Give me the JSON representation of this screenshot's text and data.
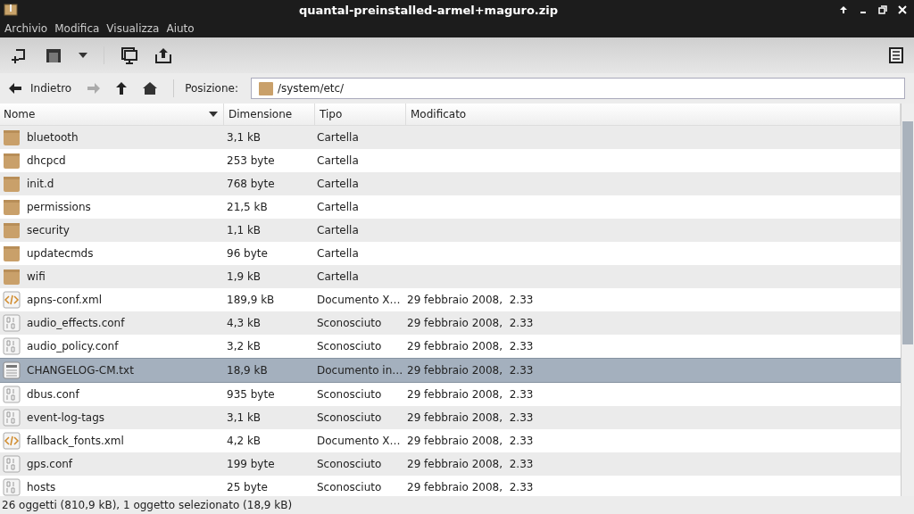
{
  "window": {
    "title": "quantal-preinstalled-armel+maguro.zip"
  },
  "menu": [
    "Archivio",
    "Modifica",
    "Visualizza",
    "Aiuto"
  ],
  "nav": {
    "back": "Indietro",
    "location_label": "Posizione:",
    "location": "/system/etc/"
  },
  "table": {
    "columns": [
      {
        "label": "Nome",
        "sorted": true
      },
      {
        "label": "Dimensione",
        "sorted": false
      },
      {
        "label": "Tipo",
        "sorted": false
      },
      {
        "label": "Modificato",
        "sorted": false
      }
    ],
    "rows": [
      {
        "kind": "folder",
        "name": "bluetooth",
        "size": "3,1 kB",
        "type": "Cartella",
        "selected": false
      },
      {
        "kind": "folder",
        "name": "dhcpcd",
        "size": "253 byte",
        "type": "Cartella",
        "selected": false
      },
      {
        "kind": "folder",
        "name": "init.d",
        "size": "768 byte",
        "type": "Cartella",
        "selected": false
      },
      {
        "kind": "folder",
        "name": "permissions",
        "size": "21,5 kB",
        "type": "Cartella",
        "selected": false
      },
      {
        "kind": "folder",
        "name": "security",
        "size": "1,1 kB",
        "type": "Cartella",
        "selected": false
      },
      {
        "kind": "folder",
        "name": "updatecmds",
        "size": "96 byte",
        "type": "Cartella",
        "selected": false
      },
      {
        "kind": "folder",
        "name": "wifi",
        "size": "1,9 kB",
        "type": "Cartella",
        "selected": false
      },
      {
        "kind": "xml",
        "name": "apns-conf.xml",
        "size": "189,9 kB",
        "type": "Documento X…",
        "modified": "29 febbraio 2008,  2.33",
        "selected": false
      },
      {
        "kind": "binary",
        "name": "audio_effects.conf",
        "size": "4,3 kB",
        "type": "Sconosciuto",
        "modified": "29 febbraio 2008,  2.33",
        "selected": false
      },
      {
        "kind": "binary",
        "name": "audio_policy.conf",
        "size": "3,2 kB",
        "type": "Sconosciuto",
        "modified": "29 febbraio 2008,  2.33",
        "selected": false
      },
      {
        "kind": "text",
        "name": "CHANGELOG-CM.txt",
        "size": "18,9 kB",
        "type": "Documento in…",
        "modified": "29 febbraio 2008,  2.33",
        "selected": true
      },
      {
        "kind": "binary",
        "name": "dbus.conf",
        "size": "935 byte",
        "type": "Sconosciuto",
        "modified": "29 febbraio 2008,  2.33",
        "selected": false
      },
      {
        "kind": "binary",
        "name": "event-log-tags",
        "size": "3,1 kB",
        "type": "Sconosciuto",
        "modified": "29 febbraio 2008,  2.33",
        "selected": false
      },
      {
        "kind": "xml",
        "name": "fallback_fonts.xml",
        "size": "4,2 kB",
        "type": "Documento X…",
        "modified": "29 febbraio 2008,  2.33",
        "selected": false
      },
      {
        "kind": "binary",
        "name": "gps.conf",
        "size": "199 byte",
        "type": "Sconosciuto",
        "modified": "29 febbraio 2008,  2.33",
        "selected": false
      },
      {
        "kind": "binary",
        "name": "hosts",
        "size": "25 byte",
        "type": "Sconosciuto",
        "modified": "29 febbraio 2008,  2.33",
        "selected": false
      }
    ]
  },
  "status_bar": "26 oggetti (810,9 kB), 1 oggetto selezionato (18,9 kB)"
}
